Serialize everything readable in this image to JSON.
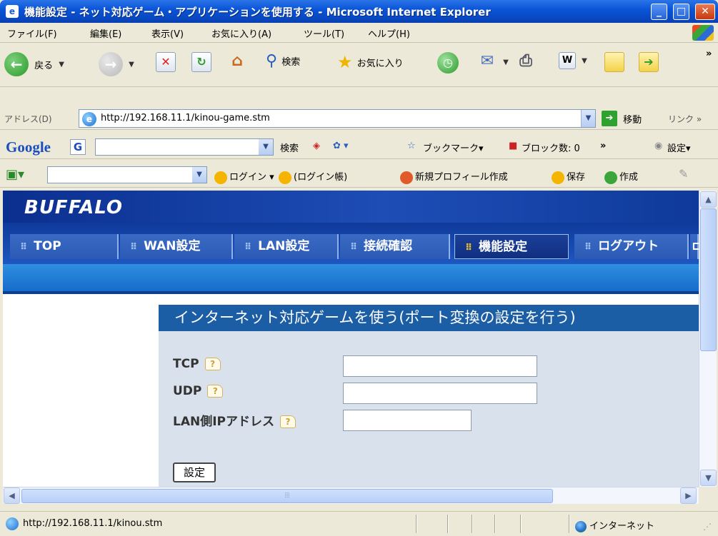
{
  "window": {
    "title": "機能設定 - ネット対応ゲーム・アプリケーションを使用する - Microsoft Internet Explorer"
  },
  "menu": [
    "ファイル(F)",
    "編集(E)",
    "表示(V)",
    "お気に入り(A)",
    "ツール(T)",
    "ヘルプ(H)"
  ],
  "toolbar": {
    "back": "戻る",
    "search": "検索",
    "favorites": "お気に入り",
    "more": "»"
  },
  "address": {
    "label": "アドレス(D)",
    "url": "http://192.168.11.1/kinou-game.stm",
    "go": "移動",
    "links": "リンク »"
  },
  "googlebar": {
    "logo_g": "Google",
    "search": "検索",
    "bookmarks": "ブックマーク▾",
    "blocked": "ブロック数: 0",
    "more": "»",
    "settings": "設定▾"
  },
  "toolbar3": {
    "login": "ログイン ▾",
    "login_book": "(ログイン帳)",
    "new_profile": "新規プロフィール作成",
    "save": "保存",
    "create": "作成"
  },
  "router": {
    "logo": "BUFFALO",
    "tabs": [
      {
        "label": "TOP",
        "active": false
      },
      {
        "label": "WAN設定",
        "active": false
      },
      {
        "label": "LAN設定",
        "active": false
      },
      {
        "label": "接続確認",
        "active": false
      },
      {
        "label": "機能設定",
        "active": true
      },
      {
        "label": "ログアウト",
        "active": false
      }
    ],
    "page_title": "インターネット対応ゲームを使う(ポート変換の設定を行う)",
    "fields": [
      {
        "label": "TCP",
        "value": ""
      },
      {
        "label": "UDP",
        "value": ""
      },
      {
        "label": "LAN側IPアドレス",
        "value": ""
      }
    ],
    "submit": "設定"
  },
  "status": {
    "url": "http://192.168.11.1/kinou.stm",
    "zone": "インターネット"
  }
}
